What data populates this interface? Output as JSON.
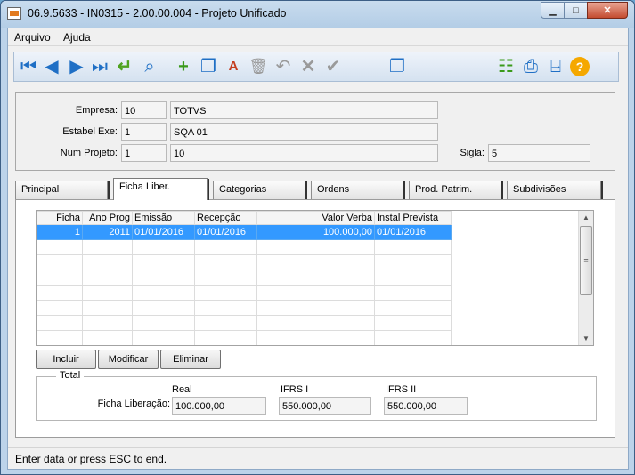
{
  "window": {
    "title": "06.9.5633 - IN0315 - 2.00.00.004 - Projeto Unificado",
    "minimize": "▁",
    "maximize": "□",
    "close": "✕"
  },
  "menu": {
    "arquivo": "Arquivo",
    "ajuda": "Ajuda"
  },
  "toolbar": {
    "first": "⏮",
    "prev": "◀",
    "next": "▶",
    "last": "⏭",
    "enter": "↵",
    "search": "⌕",
    "add": "+",
    "copy": "❐",
    "edit": "A",
    "delete": "🗑",
    "undo": "↶",
    "cancel": "✕",
    "confirm": "✔",
    "windows": "❐",
    "tree": "☷",
    "print": "⎙",
    "exit": "⍈",
    "help": "?"
  },
  "form": {
    "empresa": {
      "label": "Empresa:",
      "code": "10",
      "name": "TOTVS"
    },
    "estabel": {
      "label": "Estabel Exe:",
      "code": "1",
      "name": "SQA 01"
    },
    "projeto": {
      "label": "Num Projeto:",
      "code": "1",
      "name": "10"
    },
    "sigla": {
      "label": "Sigla:",
      "value": "5"
    }
  },
  "tabs": [
    "Principal",
    "Ficha Liber.",
    "Categorias",
    "Ordens",
    "Prod. Patrim.",
    "Subdivisões"
  ],
  "grid": {
    "headers": [
      "Ficha",
      "Ano Prog",
      "Emissão",
      "Recepção",
      "Valor Verba",
      "Instal Prevista"
    ],
    "row": [
      "1",
      "2011",
      "01/01/2016",
      "01/01/2016",
      "100.000,00",
      "01/01/2016"
    ]
  },
  "buttons": {
    "incluir": "Incluir",
    "modificar": "Modificar",
    "eliminar": "Eliminar"
  },
  "total": {
    "title": "Total",
    "row_label": "Ficha Liberação:",
    "cols": [
      {
        "label": "Real",
        "value": "100.000,00"
      },
      {
        "label": "IFRS I",
        "value": "550.000,00"
      },
      {
        "label": "IFRS II",
        "value": "550.000,00"
      }
    ]
  },
  "status": "Enter data or press ESC to end.",
  "colors": {
    "accent": "#3399ff",
    "toolbar_blue": "#1f6fc5",
    "help": "#f5a800"
  }
}
